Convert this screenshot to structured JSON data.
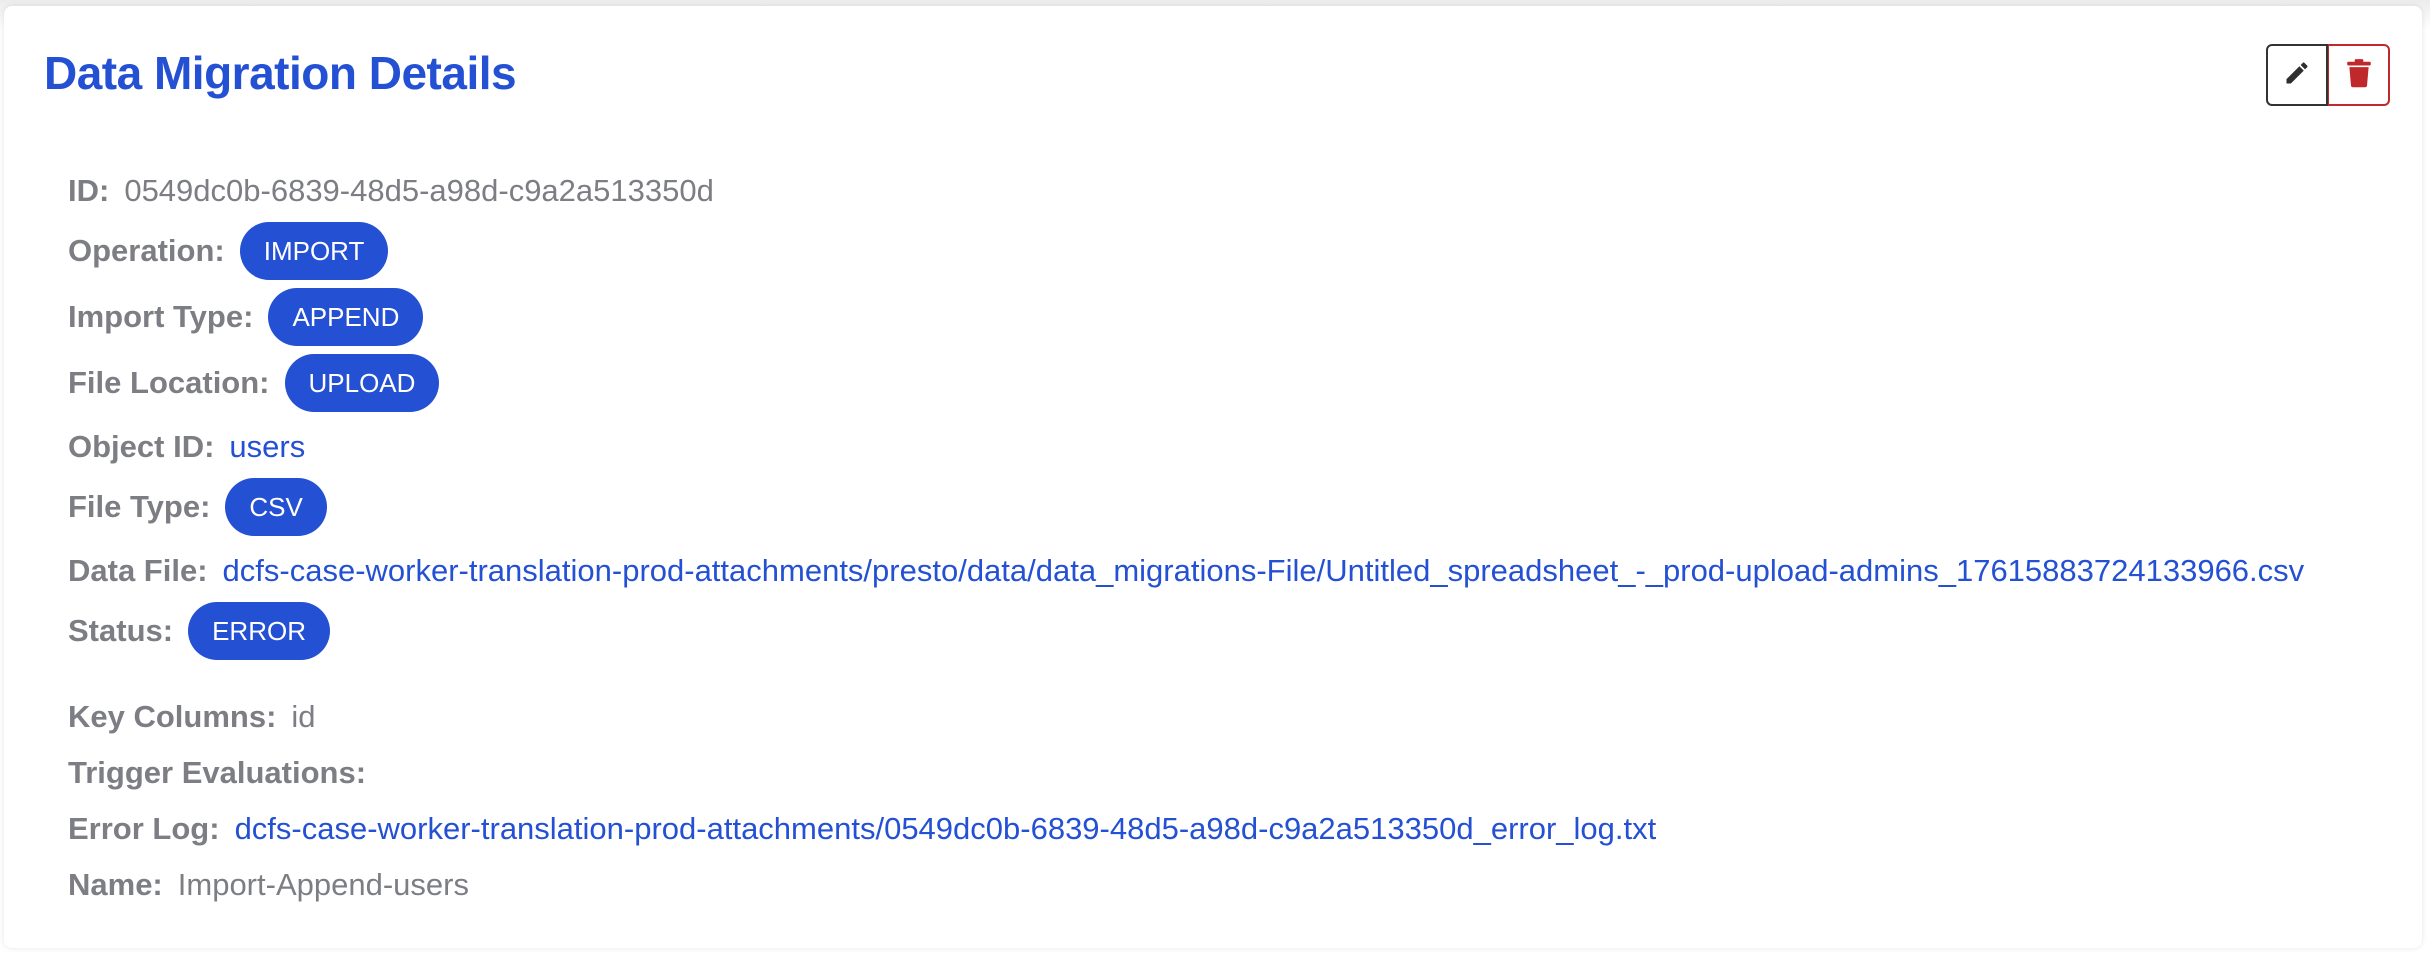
{
  "title": "Data Migration Details",
  "actions": {
    "edit_icon": "pencil-icon",
    "delete_icon": "trash-icon"
  },
  "colors": {
    "primary": "#2450d4",
    "danger": "#c0292b",
    "label": "#7c7e84"
  },
  "fields": {
    "id": {
      "label": "ID:",
      "value": "0549dc0b-6839-48d5-a98d-c9a2a513350d"
    },
    "operation": {
      "label": "Operation:",
      "value": "IMPORT"
    },
    "import_type": {
      "label": "Import Type:",
      "value": "APPEND"
    },
    "file_location": {
      "label": "File Location:",
      "value": "UPLOAD"
    },
    "object_id": {
      "label": "Object ID:",
      "value": "users"
    },
    "file_type": {
      "label": "File Type:",
      "value": "CSV"
    },
    "data_file": {
      "label": "Data File:",
      "value": "dcfs-case-worker-translation-prod-attachments/presto/data/data_migrations-File/Untitled_spreadsheet_-_prod-upload-admins_17615883724133966.csv"
    },
    "status": {
      "label": "Status:",
      "value": "ERROR"
    },
    "key_columns": {
      "label": "Key Columns:",
      "value": "id"
    },
    "trigger_evaluations": {
      "label": "Trigger Evaluations:",
      "value": ""
    },
    "error_log": {
      "label": "Error Log:",
      "value": "dcfs-case-worker-translation-prod-attachments/0549dc0b-6839-48d5-a98d-c9a2a513350d_error_log.txt"
    },
    "name": {
      "label": "Name:",
      "value": "Import-Append-users"
    }
  }
}
